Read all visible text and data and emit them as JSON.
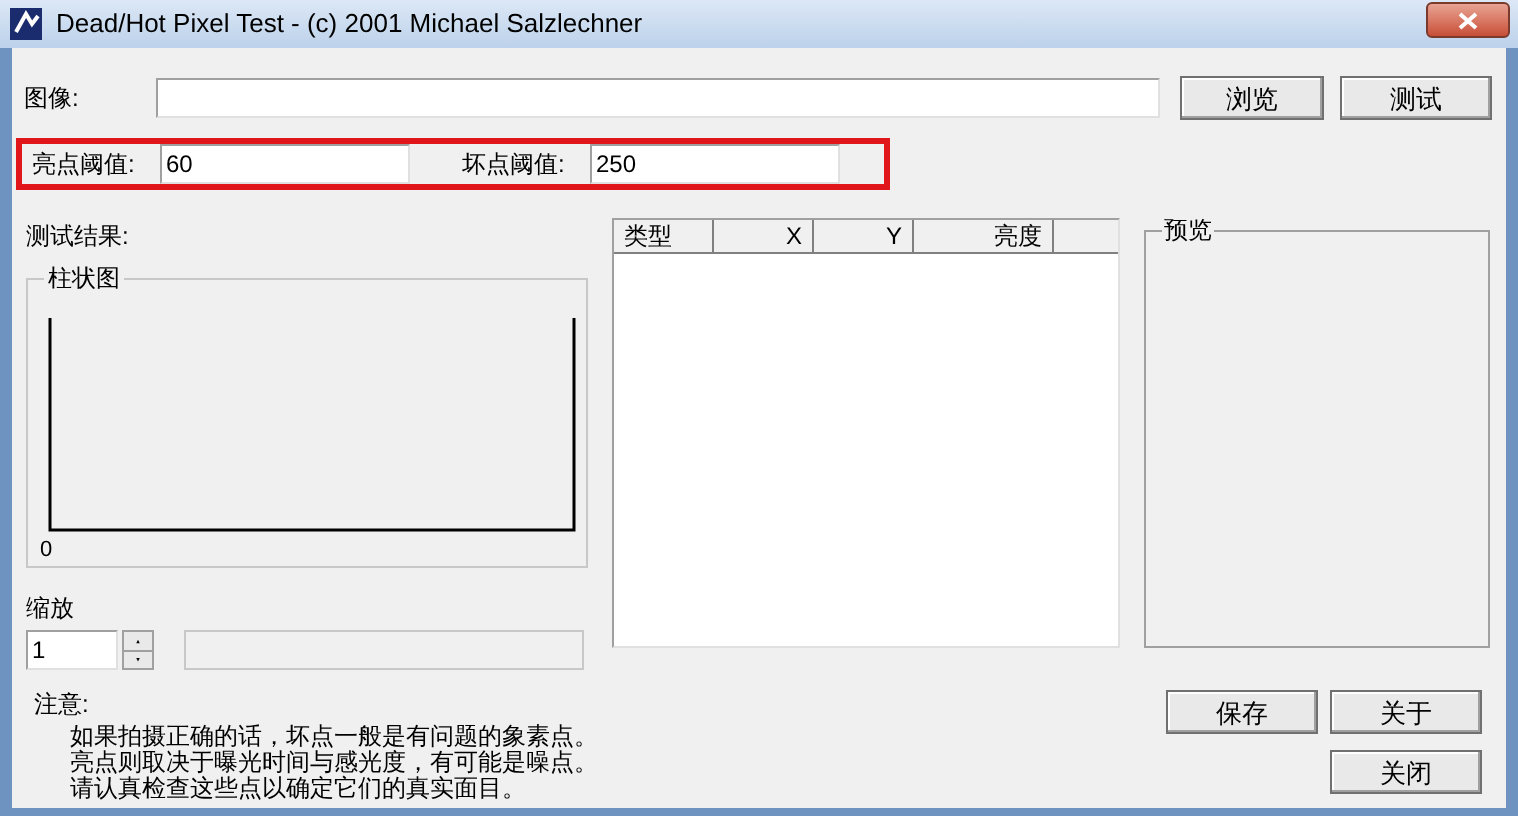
{
  "window": {
    "title": "Dead/Hot Pixel Test - (c) 2001 Michael Salzlechner"
  },
  "image_row": {
    "label": "图像:",
    "buttons": [
      "浏览",
      "测试"
    ]
  },
  "thresholds": {
    "highlighted": true,
    "fields": [
      {
        "label": "亮点阈值:",
        "value": "60"
      },
      {
        "label": "坏点阈值:",
        "value": "250"
      }
    ]
  },
  "results": {
    "label": "测试结果:",
    "histogram": {
      "title": "柱状图",
      "axis_label": "0"
    }
  },
  "zoom": {
    "label": "缩放",
    "value": "1"
  },
  "table": {
    "columns": [
      "类型",
      "X",
      "Y",
      "亮度"
    ]
  },
  "preview": {
    "title": "预览"
  },
  "note": {
    "label": "注意:",
    "lines": [
      "如果拍摄正确的话，坏点一般是有问题的象素点。",
      "亮点则取决于曝光时间与感光度，有可能是噪点。",
      "请认真检查这些点以确定它们的真实面目。"
    ]
  },
  "buttons": [
    "保存",
    "关于",
    "关闭"
  ]
}
